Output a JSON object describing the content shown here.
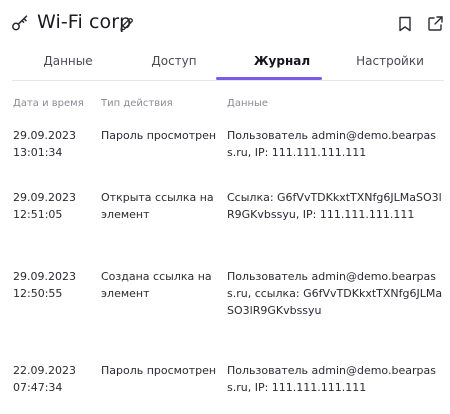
{
  "header": {
    "title": "Wi-Fi corp",
    "icons": [
      "key-icon",
      "edit-icon",
      "bookmark-icon",
      "external-link-icon"
    ]
  },
  "tabs": [
    {
      "label": "Данные"
    },
    {
      "label": "Доступ"
    },
    {
      "label": "Журнал"
    },
    {
      "label": "Настройки"
    }
  ],
  "active_tab": "Журнал",
  "accent_color": "#7b5ae6",
  "table": {
    "columns": [
      "Дата и время",
      "Тип действия",
      "Данные"
    ],
    "rows": [
      {
        "date": "29.09.2023",
        "time": "13:01:34",
        "action": "Пароль просмотрен",
        "data": "Пользователь admin@demo.bearpass.ru, IP: 111.111.111.111"
      },
      {
        "date": "29.09.2023",
        "time": "12:51:05",
        "action": "Открыта ссылка на элемент",
        "data": "Ссылка: G6fVvTDKkxtTXNfg6JLMaSO3lR9GKvbssyu, IP: 111.111.111.111"
      },
      {
        "date": "29.09.2023",
        "time": "12:50:55",
        "action": "Создана ссылка на элемент",
        "data": "Пользователь admin@demo.bearpass.ru, ссылка: G6fVvTDKkxtTXNfg6JLMaSO3lR9GKvbssyu"
      },
      {
        "date": "22.09.2023",
        "time": "07:47:34",
        "action": "Пароль просмотрен",
        "data": "Пользователь admin@demo.bearpass.ru, IP: 111.111.111.111"
      }
    ]
  }
}
